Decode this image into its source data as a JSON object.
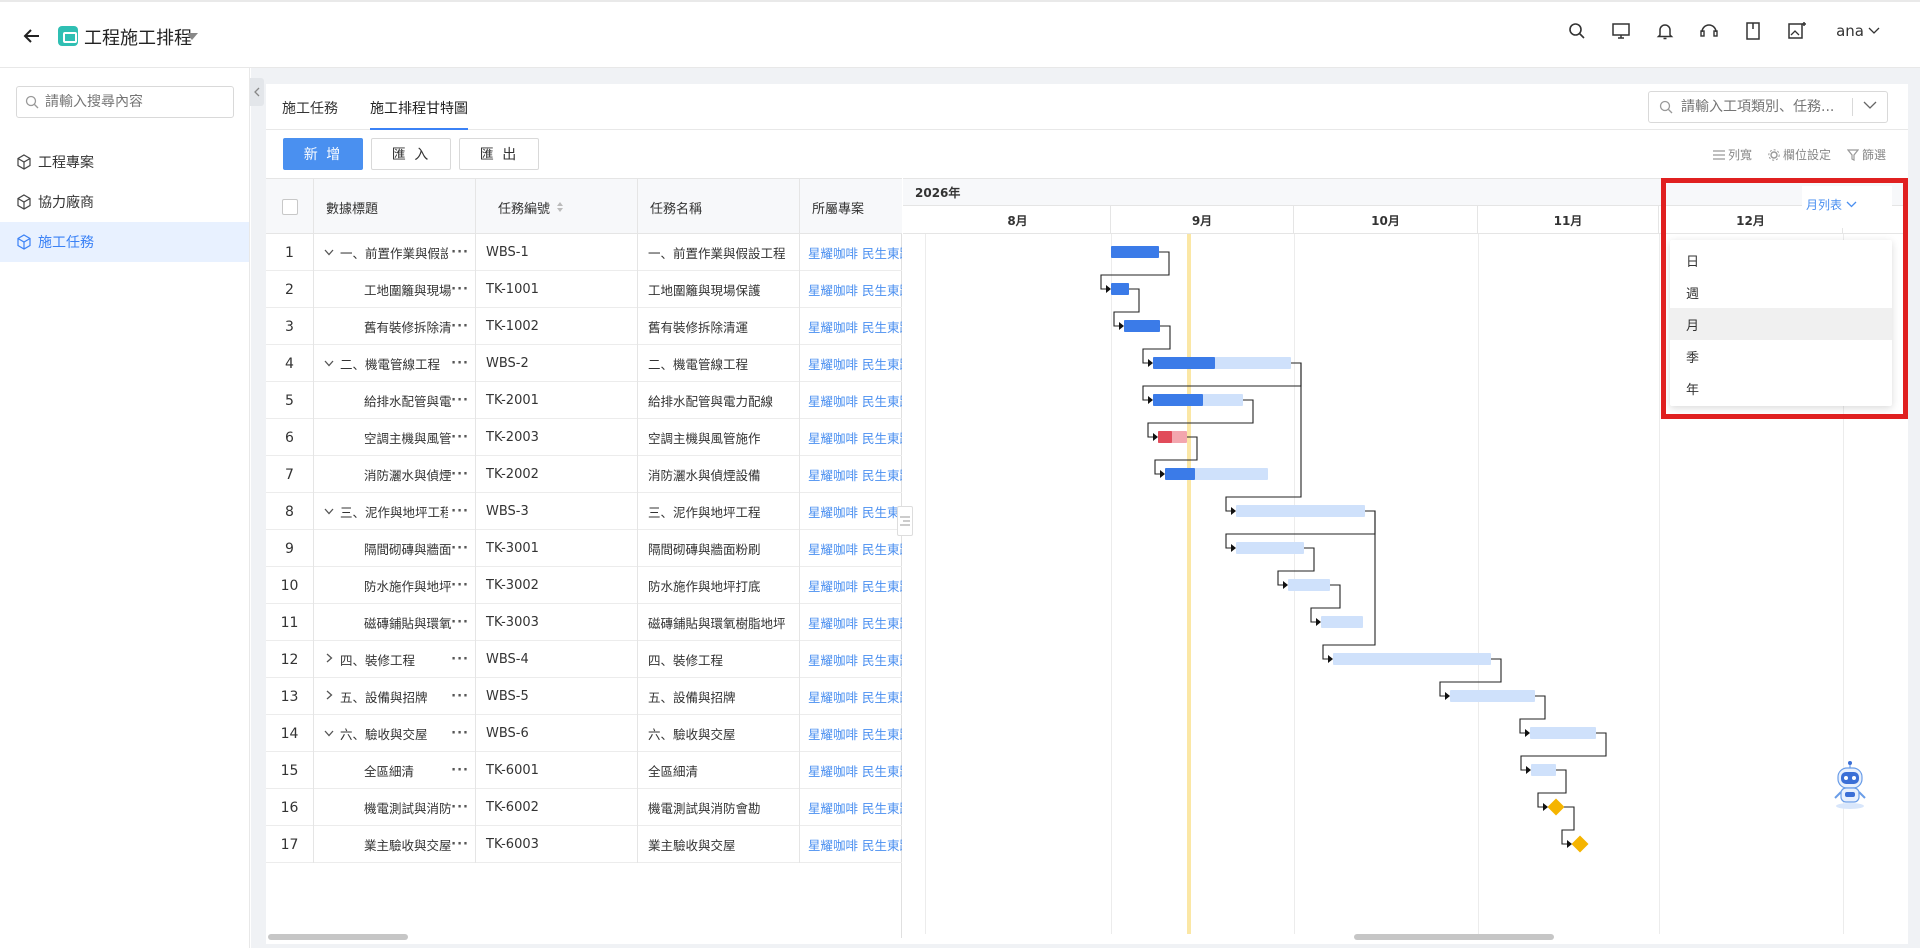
{
  "app": {
    "title": "工程施工排程",
    "user": "ana"
  },
  "sidebar": {
    "search_placeholder": "請輸入搜尋內容",
    "items": [
      {
        "label": "工程專案",
        "active": false
      },
      {
        "label": "協力廠商",
        "active": false
      },
      {
        "label": "施工任務",
        "active": true
      }
    ]
  },
  "tabs": [
    {
      "label": "施工任務",
      "active": false
    },
    {
      "label": "施工排程甘特圖",
      "active": true
    }
  ],
  "top_search": {
    "placeholder": "請輸入工項類別、任務..."
  },
  "toolbar": {
    "add_label": "新 增",
    "import_label": "匯 入",
    "export_label": "匯 出",
    "list_label": "列寬",
    "column_settings_label": "欄位設定",
    "filter_label": "篩選"
  },
  "grid": {
    "headers": {
      "title": "數據標題",
      "code": "任務編號",
      "name": "任務名稱",
      "project": "所屬專案"
    },
    "rows": [
      {
        "num": "1",
        "caret": "down",
        "indent": 0,
        "title": "一、前置作業與假設工程",
        "code": "WBS-1",
        "name": "一、前置作業與假設工程",
        "project": "星耀咖啡 民生東路店"
      },
      {
        "num": "2",
        "caret": "none",
        "indent": 1,
        "title": "工地圍籬與現場保護",
        "code": "TK-1001",
        "name": "工地圍籬與現場保護",
        "project": "星耀咖啡 民生東路店"
      },
      {
        "num": "3",
        "caret": "none",
        "indent": 1,
        "title": "舊有裝修拆除清運",
        "code": "TK-1002",
        "name": "舊有裝修拆除清運",
        "project": "星耀咖啡 民生東路店"
      },
      {
        "num": "4",
        "caret": "down",
        "indent": 0,
        "title": "二、機電管線工程",
        "code": "WBS-2",
        "name": "二、機電管線工程",
        "project": "星耀咖啡 民生東路店"
      },
      {
        "num": "5",
        "caret": "none",
        "indent": 1,
        "title": "給排水配管與電力配線",
        "code": "TK-2001",
        "name": "給排水配管與電力配線",
        "project": "星耀咖啡 民生東路店"
      },
      {
        "num": "6",
        "caret": "none",
        "indent": 1,
        "title": "空調主機與風管施作",
        "code": "TK-2003",
        "name": "空調主機與風管施作",
        "project": "星耀咖啡 民生東路店"
      },
      {
        "num": "7",
        "caret": "none",
        "indent": 1,
        "title": "消防灑水與偵煙設備",
        "code": "TK-2002",
        "name": "消防灑水與偵煙設備",
        "project": "星耀咖啡 民生東路店"
      },
      {
        "num": "8",
        "caret": "down",
        "indent": 0,
        "title": "三、泥作與地坪工程",
        "code": "WBS-3",
        "name": "三、泥作與地坪工程",
        "project": "星耀咖啡 民生東路店"
      },
      {
        "num": "9",
        "caret": "none",
        "indent": 1,
        "title": "隔間砌磚與牆面粉刷",
        "code": "TK-3001",
        "name": "隔間砌磚與牆面粉刷",
        "project": "星耀咖啡 民生東路店"
      },
      {
        "num": "10",
        "caret": "none",
        "indent": 1,
        "title": "防水施作與地坪打底",
        "code": "TK-3002",
        "name": "防水施作與地坪打底",
        "project": "星耀咖啡 民生東路店"
      },
      {
        "num": "11",
        "caret": "none",
        "indent": 1,
        "title": "磁磚鋪貼與環氧樹脂地坪",
        "code": "TK-3003",
        "name": "磁磚鋪貼與環氧樹脂地坪",
        "project": "星耀咖啡 民生東路店"
      },
      {
        "num": "12",
        "caret": "right",
        "indent": 0,
        "title": "四、裝修工程",
        "code": "WBS-4",
        "name": "四、裝修工程",
        "project": "星耀咖啡 民生東路店"
      },
      {
        "num": "13",
        "caret": "right",
        "indent": 0,
        "title": "五、設備與招牌",
        "code": "WBS-5",
        "name": "五、設備與招牌",
        "project": "星耀咖啡 民生東路店"
      },
      {
        "num": "14",
        "caret": "down",
        "indent": 0,
        "title": "六、驗收與交屋",
        "code": "WBS-6",
        "name": "六、驗收與交屋",
        "project": "星耀咖啡 民生東路店"
      },
      {
        "num": "15",
        "caret": "none",
        "indent": 1,
        "title": "全區細清",
        "code": "TK-6001",
        "name": "全區細清",
        "project": "星耀咖啡 民生東路店"
      },
      {
        "num": "16",
        "caret": "none",
        "indent": 1,
        "title": "機電測試與消防會勘",
        "code": "TK-6002",
        "name": "機電測試與消防會勘",
        "project": "星耀咖啡 民生東路店"
      },
      {
        "num": "17",
        "caret": "none",
        "indent": 1,
        "title": "業主驗收與交屋",
        "code": "TK-6003",
        "name": "業主驗收與交屋",
        "project": "星耀咖啡 民生東路店"
      }
    ]
  },
  "gantt": {
    "year": "2026年",
    "months": [
      "8月",
      "9月",
      "10月",
      "11月",
      "12月"
    ],
    "view_label": "月列表",
    "view_options": [
      "日",
      "週",
      "月",
      "季",
      "年"
    ],
    "selected_view": "月",
    "colors": {
      "progress": "#3b7be8",
      "planned": "#cfe1fb",
      "overdue": "#e14b5a",
      "overdue_light": "#f3a6ae",
      "milestone": "#f5b400",
      "today": "#fbe7a5"
    }
  }
}
